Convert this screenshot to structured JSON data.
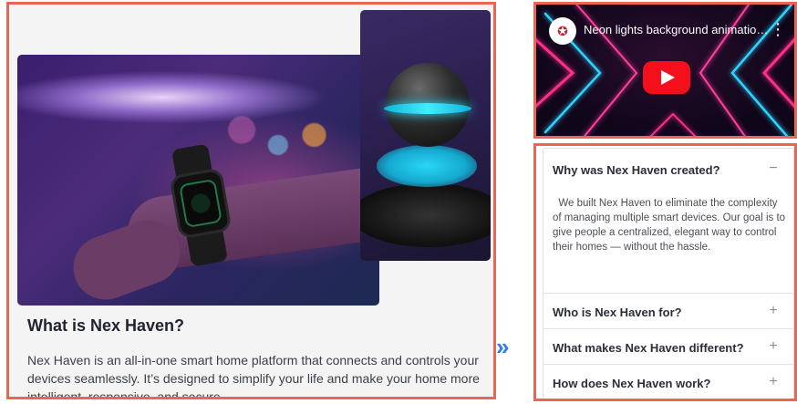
{
  "left_card": {
    "title": "What is Nex Haven?",
    "description": "Nex Haven is an all-in-one smart home platform that connects and controls your devices seamlessly. It’s designed to simplify your life and make your home more intelligent, responsive, and secure."
  },
  "arrow": {
    "glyph": "»",
    "color": "#2d7bf0"
  },
  "video": {
    "title": "Neon lights background animatio…",
    "channel_logo_glyph": "✪",
    "kebab_glyph": "⋮",
    "play_color": "#f40f1a"
  },
  "faq": {
    "items": [
      {
        "question": "Why was Nex Haven created?",
        "toggle": "−",
        "expanded": true,
        "answer": "We built Nex Haven to eliminate the complexity of managing multiple smart devices. Our goal is to give people a centralized, elegant way to control their homes — without the hassle."
      },
      {
        "question": "Who is Nex Haven for?",
        "toggle": "+",
        "expanded": false
      },
      {
        "question": "What makes Nex Haven different?",
        "toggle": "+",
        "expanded": false
      },
      {
        "question": "How does Nex Haven work?",
        "toggle": "+",
        "expanded": false
      }
    ]
  },
  "colors": {
    "highlight_border": "#ee6452",
    "accent": "#2d7bf0"
  }
}
